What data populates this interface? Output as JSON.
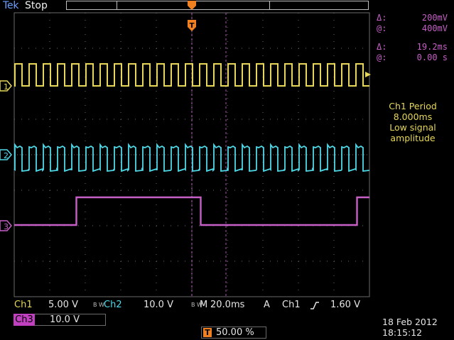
{
  "header": {
    "brand": "Tek",
    "run_state": "Stop"
  },
  "cursors": {
    "delta_v_symbol": "Δ:",
    "delta_v": "200mV",
    "at_v_symbol": "@:",
    "at_v": "400mV",
    "delta_t_symbol": "Δ:",
    "delta_t": "19.2ms",
    "at_t_symbol": "@:",
    "at_t": "0.00 s"
  },
  "measurement": {
    "line1": "Ch1 Period",
    "line2": "8.000ms",
    "line3": "Low signal",
    "line4": "amplitude"
  },
  "channels": {
    "ch1_label": "Ch1",
    "ch1_scale": "5.00 V",
    "ch2_label": "Ch2",
    "ch2_scale": "10.0 V",
    "ch3_label": "Ch3",
    "ch3_scale": "10.0 V",
    "marker_1": "1",
    "marker_2": "2",
    "marker_3": "3",
    "bw_mark": "B W"
  },
  "timebase": {
    "label": "M",
    "value": "20.0ms",
    "acq_mode": "A",
    "trigger_source": "Ch1",
    "trigger_level": "1.60 V"
  },
  "trigger": {
    "position": "50.00 %",
    "icon_letter": "T"
  },
  "timestamp": {
    "date": "18 Feb  2012",
    "time": "18:15:12"
  },
  "colors": {
    "ch1": "#e6d75a",
    "ch2": "#4fd8e8",
    "ch3": "#c65fc6",
    "trigger": "#f08020",
    "grid": "#6a6a6a"
  },
  "signals": {
    "ch1_period_ms": 8.0,
    "ch1_cycles_on_screen": 25,
    "ch2_cycles_on_screen": 25,
    "ch3_edges_divisions": [
      1.75,
      5.25,
      9.65
    ]
  }
}
